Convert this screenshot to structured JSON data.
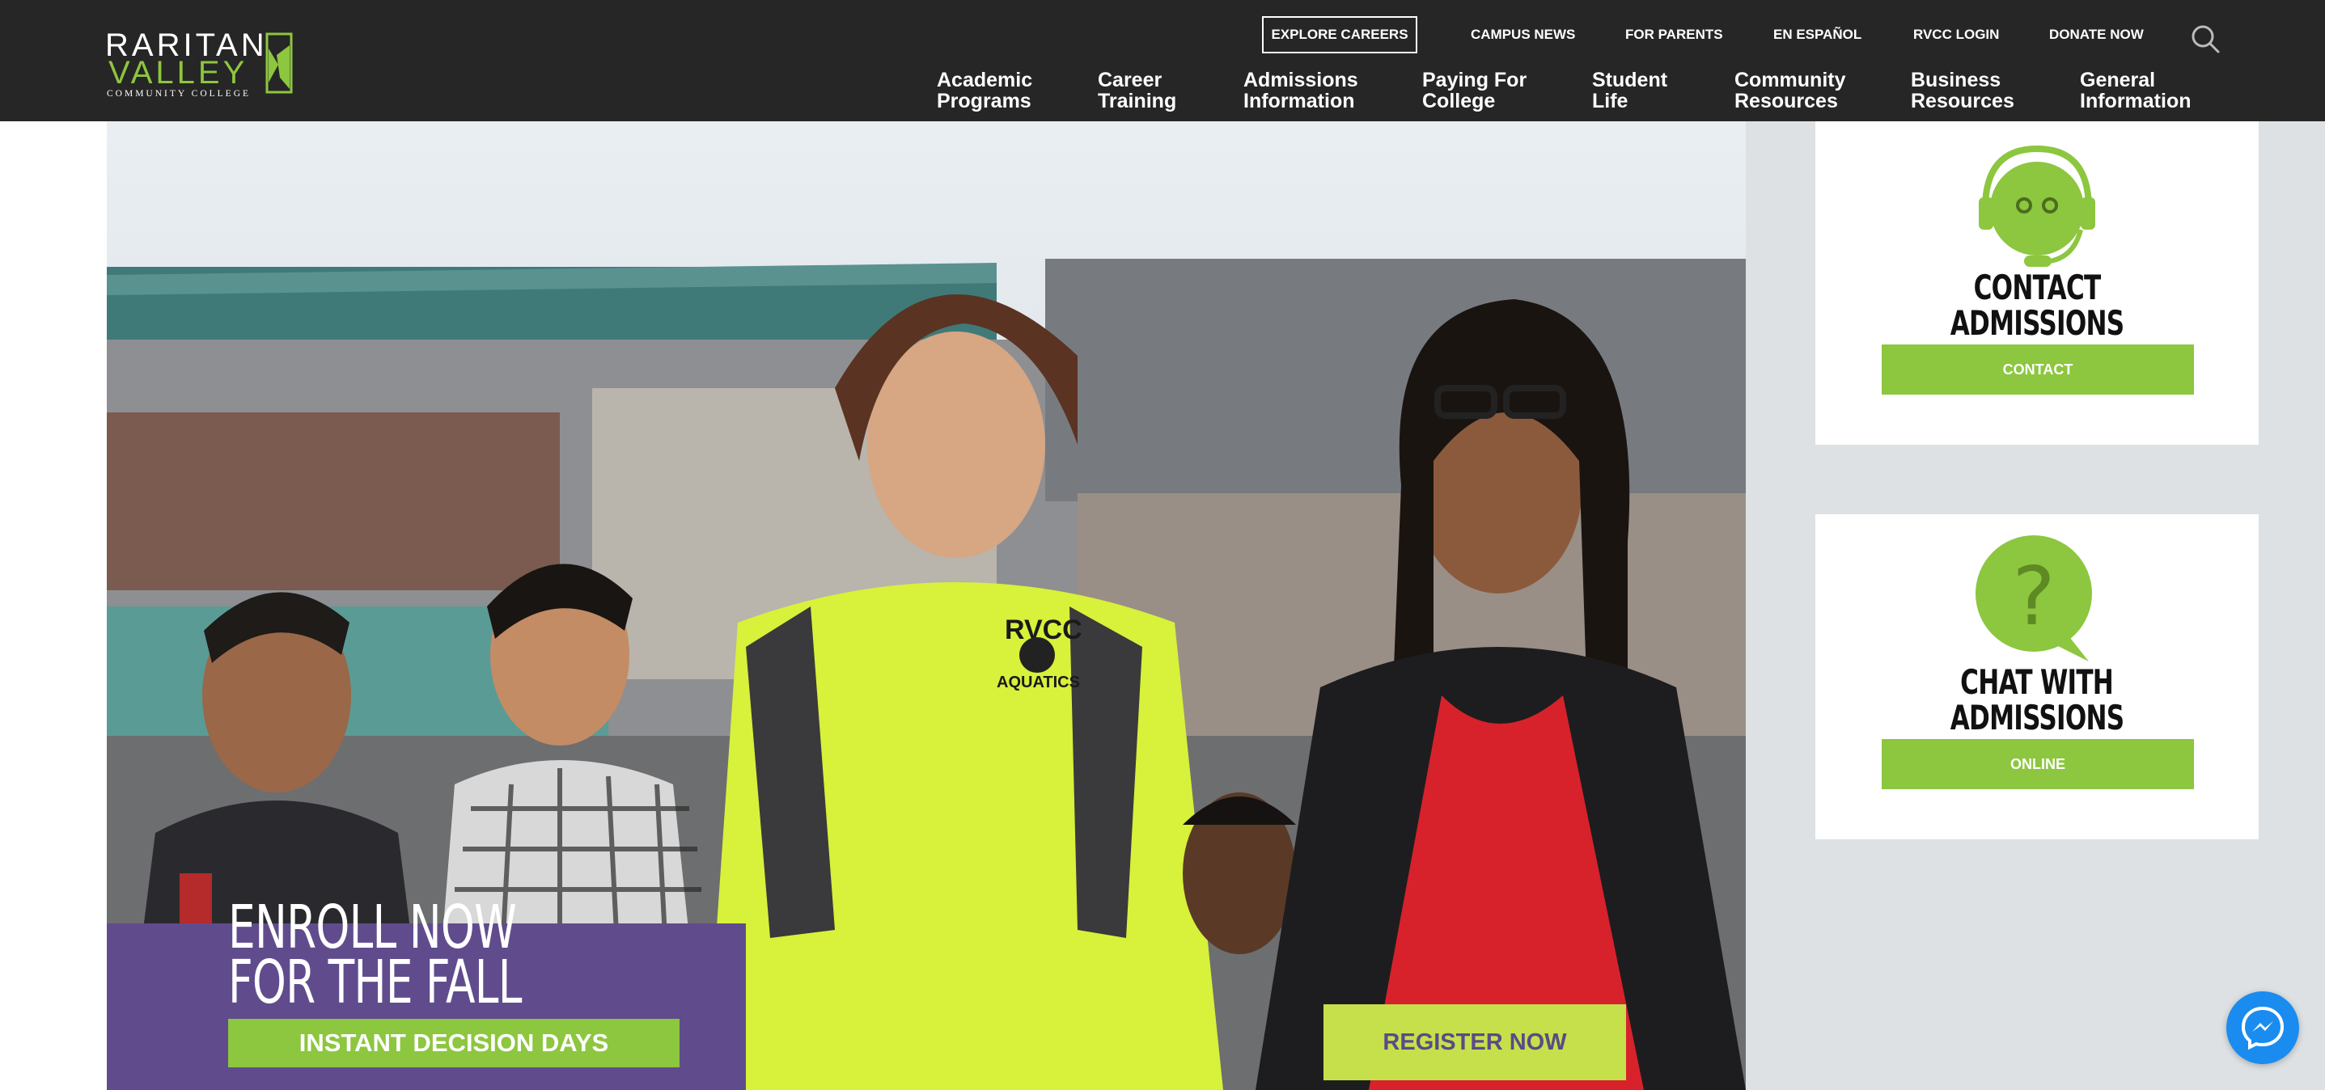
{
  "logo": {
    "line1": "RARITAN",
    "line2": "VALLEY",
    "line3": "COMMUNITY COLLEGE"
  },
  "utility_nav": {
    "explore_careers": "EXPLORE CAREERS",
    "campus_news": "CAMPUS NEWS",
    "for_parents": "FOR PARENTS",
    "en_espanol": "EN ESPAÑOL",
    "rvcc_login": "RVCC LOGIN",
    "donate_now": "DONATE NOW"
  },
  "main_nav": [
    {
      "line1": "Academic",
      "line2": "Programs"
    },
    {
      "line1": "Career",
      "line2": "Training"
    },
    {
      "line1": "Admissions",
      "line2": "Information"
    },
    {
      "line1": "Paying For",
      "line2": "College"
    },
    {
      "line1": "Student",
      "line2": "Life"
    },
    {
      "line1": "Community",
      "line2": "Resources"
    },
    {
      "line1": "Business",
      "line2": "Resources"
    },
    {
      "line1": "General",
      "line2": "Information"
    }
  ],
  "hero": {
    "headline_line1": "ENROLL NOW",
    "headline_line2": "FOR THE FALL",
    "decision_days": "INSTANT DECISION DAYS",
    "register": "REGISTER NOW",
    "shirt_text_1": "RVCC",
    "shirt_text_2": "AQUATICS"
  },
  "sidebar": {
    "contact_card": {
      "title_line1": "CONTACT",
      "title_line2": "ADMISSIONS",
      "button": "CONTACT"
    },
    "chat_card": {
      "title_line1": "CHAT WITH",
      "title_line2": "ADMISSIONS",
      "button": "ONLINE"
    }
  },
  "colors": {
    "header_bg": "#262626",
    "brand_green": "#8dc63f",
    "purple": "#604c8d",
    "register_yellow": "#c5e04b",
    "sidebar_bg": "#dde1e3",
    "messenger_blue": "#1a8cf0"
  },
  "icons": [
    "search-icon",
    "headset-robot-icon",
    "question-bubble-icon",
    "messenger-icon"
  ]
}
